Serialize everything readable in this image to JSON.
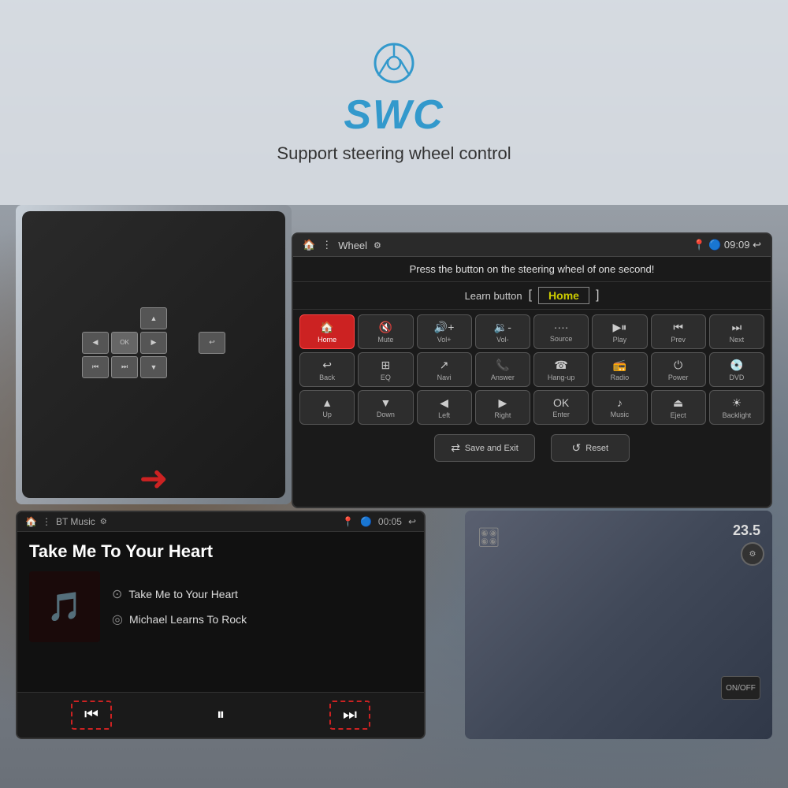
{
  "header": {
    "icon": "🎮",
    "title": "SWC",
    "subtitle": "Support steering wheel control"
  },
  "swc_panel": {
    "title": "Wheel",
    "time": "09:09",
    "status_msg": "Press the button on the steering wheel of one second!",
    "learn_label": "Learn button",
    "learn_bracket_open": "[",
    "learn_bracket_close": "]",
    "learn_active": "Home",
    "buttons": [
      {
        "icon": "🏠",
        "label": "Home",
        "active": true
      },
      {
        "icon": "🔇",
        "label": "Mute",
        "active": false
      },
      {
        "icon": "🔊+",
        "label": "Vol+",
        "active": false
      },
      {
        "icon": "🔉-",
        "label": "Vol-",
        "active": false
      },
      {
        "icon": "····",
        "label": "Source",
        "active": false
      },
      {
        "icon": "▶⏸",
        "label": "Play",
        "active": false
      },
      {
        "icon": "⏮",
        "label": "Prev",
        "active": false
      },
      {
        "icon": "⏭",
        "label": "Next",
        "active": false
      },
      {
        "icon": "↩",
        "label": "Back",
        "active": false
      },
      {
        "icon": "⊞",
        "label": "EQ",
        "active": false
      },
      {
        "icon": "↗",
        "label": "Navi",
        "active": false
      },
      {
        "icon": "📞",
        "label": "Answer",
        "active": false
      },
      {
        "icon": "☎",
        "label": "Hang-up",
        "active": false
      },
      {
        "icon": "📻",
        "label": "Radio",
        "active": false
      },
      {
        "icon": "⏻",
        "label": "Power",
        "active": false
      },
      {
        "icon": "💿",
        "label": "DVD",
        "active": false
      },
      {
        "icon": "▲",
        "label": "Up",
        "active": false
      },
      {
        "icon": "▼",
        "label": "Down",
        "active": false
      },
      {
        "icon": "◀",
        "label": "Left",
        "active": false
      },
      {
        "icon": "▶",
        "label": "Right",
        "active": false
      },
      {
        "icon": "OK",
        "label": "Enter",
        "active": false
      },
      {
        "icon": "♪",
        "label": "Music",
        "active": false
      },
      {
        "icon": "⏏",
        "label": "Eject",
        "active": false
      },
      {
        "icon": "☀",
        "label": "Backlight",
        "active": false
      }
    ],
    "save_exit_label": "Save and Exit",
    "save_exit_icon": "⇄",
    "reset_label": "Reset",
    "reset_icon": "↺"
  },
  "bt_panel": {
    "title": "BT Music",
    "time": "00:05",
    "song_title": "Take Me To Your Heart",
    "track_name": "Take Me to Your Heart",
    "artist": "Michael Learns To Rock",
    "controls": {
      "prev": "⏮",
      "pause": "⏸",
      "next": "⏭"
    }
  }
}
